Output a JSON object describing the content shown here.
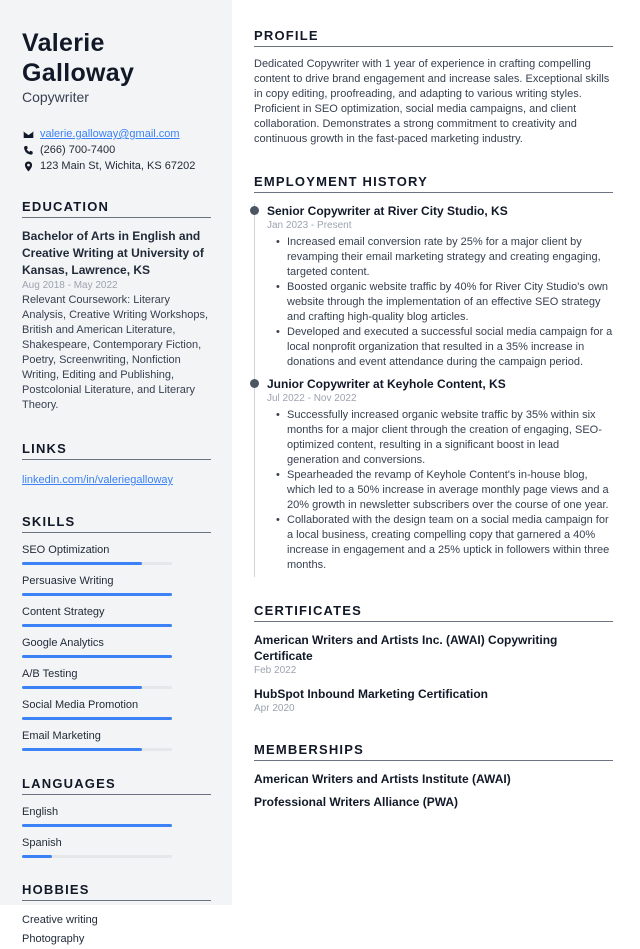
{
  "header": {
    "name": "Valerie Galloway",
    "role": "Copywriter"
  },
  "contact": {
    "email": {
      "icon": "envelope-icon",
      "value": "valerie.galloway@gmail.com"
    },
    "phone": {
      "icon": "phone-icon",
      "value": "(266) 700-7400"
    },
    "address": {
      "icon": "map-pin-icon",
      "value": "123 Main St, Wichita, KS 67202"
    }
  },
  "education": {
    "title": "EDUCATION",
    "degree": "Bachelor of Arts in English and Creative Writing at University of Kansas, Lawrence, KS",
    "dates": "Aug 2018 - May 2022",
    "description": "Relevant Coursework: Literary Analysis, Creative Writing Workshops, British and American Literature, Shakespeare, Contemporary Fiction, Poetry, Screenwriting, Nonfiction Writing, Editing and Publishing, Postcolonial Literature, and Literary Theory."
  },
  "links": {
    "title": "LINKS",
    "items": [
      "linkedin.com/in/valeriegalloway"
    ]
  },
  "skills": {
    "title": "SKILLS",
    "items": [
      {
        "label": "SEO Optimization",
        "level": 0.8
      },
      {
        "label": "Persuasive Writing",
        "level": 1.0
      },
      {
        "label": "Content Strategy",
        "level": 1.0
      },
      {
        "label": "Google Analytics",
        "level": 1.0
      },
      {
        "label": "A/B Testing",
        "level": 0.8
      },
      {
        "label": "Social Media Promotion",
        "level": 1.0
      },
      {
        "label": "Email Marketing",
        "level": 0.8
      }
    ]
  },
  "languages": {
    "title": "LANGUAGES",
    "items": [
      {
        "label": "English",
        "level": 1.0
      },
      {
        "label": "Spanish",
        "level": 0.2
      }
    ]
  },
  "hobbies": {
    "title": "HOBBIES",
    "items": [
      "Creative writing",
      "Photography"
    ]
  },
  "profile": {
    "title": "PROFILE",
    "text": "Dedicated Copywriter with 1 year of experience in crafting compelling content to drive brand engagement and increase sales. Exceptional skills in copy editing, proofreading, and adapting to various writing styles. Proficient in SEO optimization, social media campaigns, and client collaboration. Demonstrates a strong commitment to creativity and continuous growth in the fast-paced marketing industry."
  },
  "employment": {
    "title": "EMPLOYMENT HISTORY",
    "jobs": [
      {
        "title": "Senior Copywriter at River City Studio, KS",
        "dates": "Jan 2023 - Present",
        "bullets": [
          "Increased email conversion rate by 25% for a major client by revamping their email marketing strategy and creating engaging, targeted content.",
          "Boosted organic website traffic by 40% for River City Studio's own website through the implementation of an effective SEO strategy and crafting high-quality blog articles.",
          "Developed and executed a successful social media campaign for a local nonprofit organization that resulted in a 35% increase in donations and event attendance during the campaign period."
        ]
      },
      {
        "title": "Junior Copywriter at Keyhole Content, KS",
        "dates": "Jul 2022 - Nov 2022",
        "bullets": [
          "Successfully increased organic website traffic by 35% within six months for a major client through the creation of engaging, SEO-optimized content, resulting in a significant boost in lead generation and conversions.",
          "Spearheaded the revamp of Keyhole Content's in-house blog, which led to a 50% increase in average monthly page views and a 20% growth in newsletter subscribers over the course of one year.",
          "Collaborated with the design team on a social media campaign for a local business, creating compelling copy that garnered a 40% increase in engagement and a 25% uptick in followers within three months."
        ]
      }
    ]
  },
  "certificates": {
    "title": "CERTIFICATES",
    "items": [
      {
        "title": "American Writers and Artists Inc. (AWAI) Copywriting Certificate",
        "date": "Feb 2022"
      },
      {
        "title": "HubSpot Inbound Marketing Certification",
        "date": "Apr 2020"
      }
    ]
  },
  "memberships": {
    "title": "MEMBERSHIPS",
    "items": [
      "American Writers and Artists Institute (AWAI)",
      "Professional Writers Alliance (PWA)"
    ]
  },
  "colors": {
    "accent": "#3b82f6",
    "sidebar_bg": "#f3f4f6",
    "text": "#1f2937",
    "muted": "#9ca3af"
  }
}
